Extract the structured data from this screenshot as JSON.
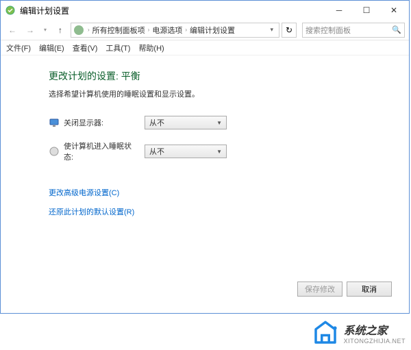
{
  "titlebar": {
    "title": "编辑计划设置"
  },
  "breadcrumb": {
    "items": [
      "所有控制面板项",
      "电源选项",
      "编辑计划设置"
    ]
  },
  "search": {
    "placeholder": "搜索控制面板"
  },
  "menubar": {
    "file": "文件(F)",
    "edit": "编辑(E)",
    "view": "查看(V)",
    "tools": "工具(T)",
    "help": "帮助(H)"
  },
  "page": {
    "heading": "更改计划的设置: 平衡",
    "subtext": "选择希望计算机使用的睡眠设置和显示设置。",
    "display_label": "关闭显示器:",
    "sleep_label": "使计算机进入睡眠状态:",
    "display_value": "从不",
    "sleep_value": "从不",
    "link_advanced": "更改高级电源设置(C)",
    "link_restore": "还原此计划的默认设置(R)"
  },
  "buttons": {
    "save": "保存修改",
    "cancel": "取消"
  },
  "watermark": {
    "main": "系统之家",
    "sub": "XITONGZHIJIA.NET"
  }
}
